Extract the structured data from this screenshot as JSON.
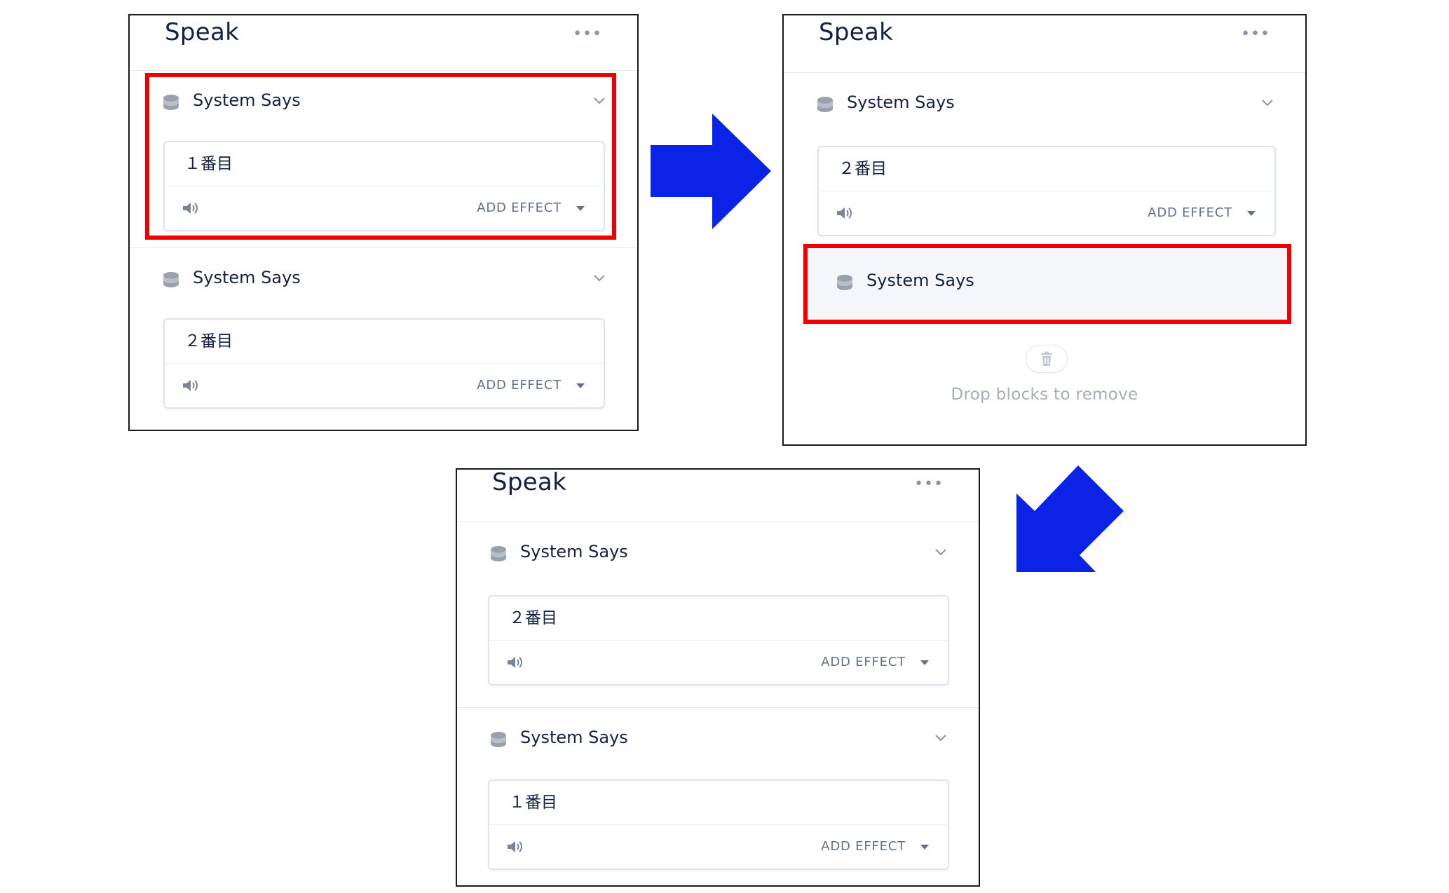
{
  "panels": [
    {
      "title": "Speak",
      "blocks": [
        {
          "title": "System Says",
          "text": "１番目",
          "add_effect": "ADD EFFECT"
        },
        {
          "title": "System Says",
          "text": "２番目",
          "add_effect": "ADD EFFECT"
        }
      ]
    },
    {
      "title": "Speak",
      "blocks": [
        {
          "title": "System Says",
          "text": "２番目",
          "add_effect": "ADD EFFECT"
        }
      ],
      "dragging_block": {
        "title": "System Says"
      },
      "drop_zone_text": "Drop blocks to remove"
    },
    {
      "title": "Speak",
      "blocks": [
        {
          "title": "System Says",
          "text": "２番目",
          "add_effect": "ADD EFFECT"
        },
        {
          "title": "System Says",
          "text": "１番目",
          "add_effect": "ADD EFFECT"
        }
      ]
    }
  ],
  "colors": {
    "highlight": "#ee0000",
    "arrow": "#0a23e6",
    "title_text": "#132144",
    "muted_text": "#a6adbb"
  },
  "icons": [
    "more-icon",
    "database-icon",
    "chevron-down-icon",
    "speaker-icon",
    "caret-down-icon",
    "trash-icon",
    "arrow-right-icon",
    "arrow-down-left-icon"
  ]
}
